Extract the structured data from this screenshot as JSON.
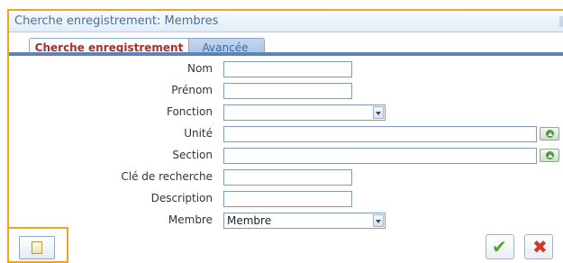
{
  "window": {
    "title": "Cherche enregistrement: Membres"
  },
  "tabs": [
    {
      "label": "Cherche enregistrement",
      "active": true
    },
    {
      "label": "Avancée",
      "active": false
    }
  ],
  "form": {
    "nom": {
      "label": "Nom",
      "value": ""
    },
    "prenom": {
      "label": "Prénom",
      "value": ""
    },
    "fonction": {
      "label": "Fonction",
      "value": ""
    },
    "unite": {
      "label": "Unité",
      "value": ""
    },
    "section": {
      "label": "Section",
      "value": ""
    },
    "cle": {
      "label": "Clé de recherche",
      "value": ""
    },
    "description": {
      "label": "Description",
      "value": ""
    },
    "membre": {
      "label": "Membre",
      "value": "Membre"
    }
  },
  "icons": {
    "new": "new-document-icon",
    "ok": "checkmark-icon",
    "cancel": "close-icon",
    "lookup": "lookup-arrow-icon",
    "dropdown": "chevron-down-icon"
  },
  "colors": {
    "highlight": "#f1a51e",
    "tab_accent": "#5b84b8",
    "ok": "#55a52f",
    "cancel": "#d03a2a"
  }
}
